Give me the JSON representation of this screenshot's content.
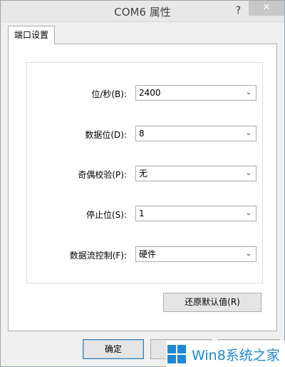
{
  "window": {
    "title": "COM6 属性",
    "help_glyph": "?",
    "close_glyph": "✕"
  },
  "tabs": [
    {
      "label": "端口设置",
      "selected": true
    }
  ],
  "settings": {
    "rows": [
      {
        "label": "位/秒(B):",
        "value": "2400"
      },
      {
        "label": "数据位(D):",
        "value": "8"
      },
      {
        "label": "奇偶校验(P):",
        "value": "无"
      },
      {
        "label": "停止位(S):",
        "value": "1"
      },
      {
        "label": "数据流控制(F):",
        "value": "硬件"
      }
    ],
    "dropdown_glyph": "⌄"
  },
  "restore_button": {
    "label": "还原默认值(R)"
  },
  "footer": {
    "ok_label": "确定",
    "cancel_label": "",
    "apply_label": ""
  },
  "watermark": {
    "text": "Win8系统之家",
    "color": "#1e88d6"
  }
}
